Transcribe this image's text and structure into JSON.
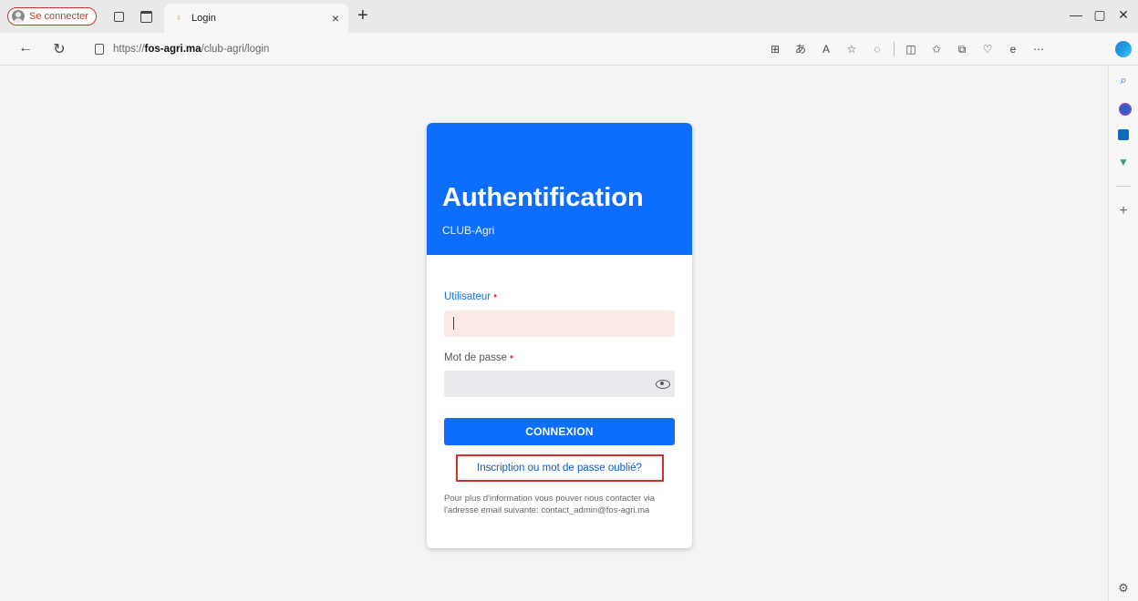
{
  "browser": {
    "profile_label": "Se connecter",
    "tab_title": "Login",
    "tab_close": "×",
    "new_tab": "+",
    "url_prefix": "https://",
    "url_domain": "fos-agri.ma",
    "url_path": "/club-agri/login",
    "win_min": "—",
    "win_max": "▢",
    "win_close": "✕"
  },
  "card": {
    "title": "Authentification",
    "subtitle": "CLUB-Agri"
  },
  "form": {
    "user_label": "Utilisateur",
    "password_label": "Mot de passe",
    "required_mark": "•",
    "submit_label": "CONNEXION",
    "register_link": "Inscription ou mot de passe oublié?",
    "info_text": "Pour plus d'information vous pouver nous contacter via l'adresse email suivante: contact_admin@fos-agri.ma"
  },
  "colors": {
    "primary": "#0d6efd",
    "highlight_border": "#d32f2f",
    "user_field_bg": "#fde8e8"
  }
}
